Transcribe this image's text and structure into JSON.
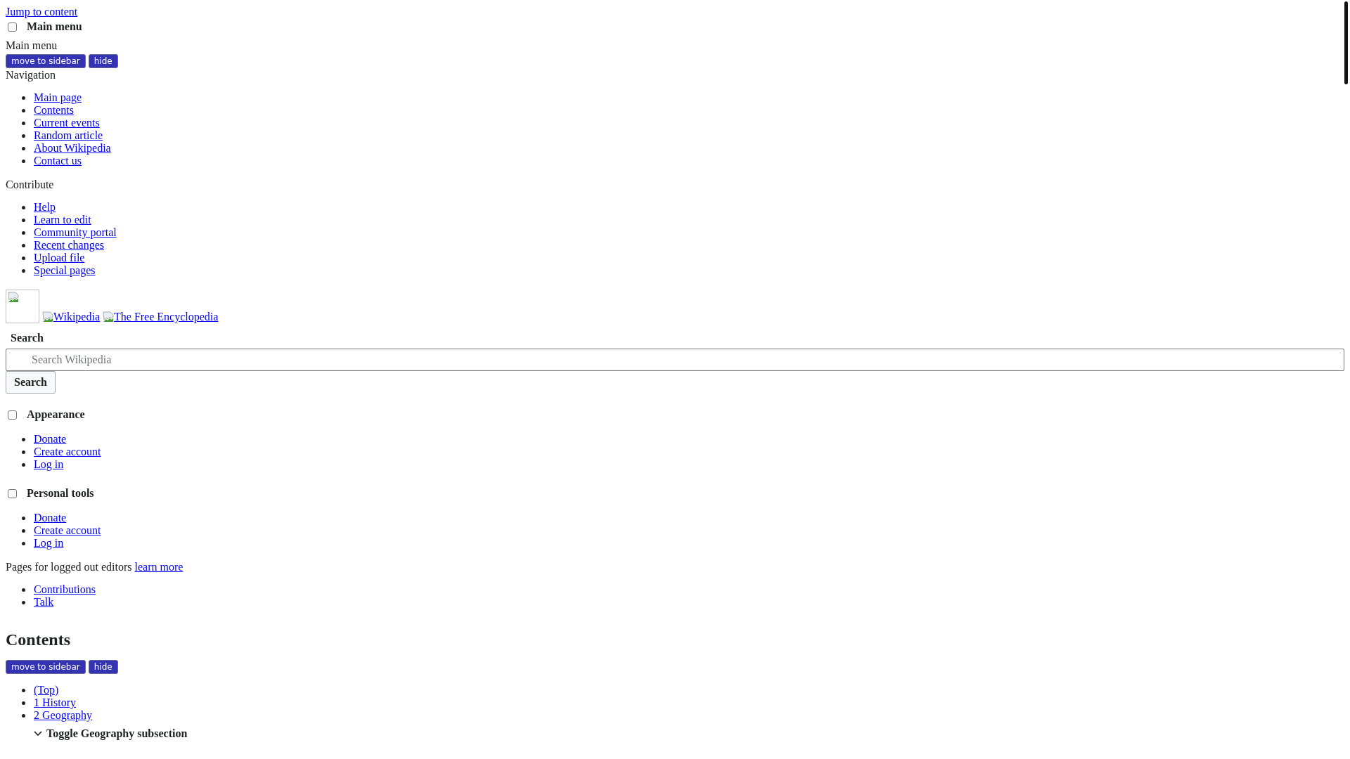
{
  "skip_link": "Jump to content",
  "main_menu": {
    "toggle": {
      "label": "Main menu",
      "checked": false
    },
    "heading": "Main menu",
    "buttons": [
      "move to sidebar",
      "hide"
    ],
    "sections": [
      {
        "heading": "Navigation",
        "items": [
          "Main page",
          "Contents",
          "Current events",
          "Random article",
          "About Wikipedia",
          "Contact us"
        ]
      },
      {
        "heading": "Contribute",
        "items": [
          "Help",
          "Learn to edit",
          "Community portal",
          "Recent changes",
          "Upload file",
          "Special pages"
        ]
      }
    ]
  },
  "logo": {
    "wordmark": "Wikipedia",
    "tagline": "The Free Encyclopedia"
  },
  "search": {
    "label": "Search",
    "placeholder": "Search Wikipedia",
    "button": "Search"
  },
  "appearance": {
    "toggle": {
      "label": "Appearance",
      "checked": false
    },
    "items": [
      "Donate",
      "Create account",
      "Log in"
    ]
  },
  "personal_tools": {
    "toggle": {
      "label": "Personal tools",
      "checked": false
    },
    "items": [
      "Donate",
      "Create account",
      "Log in"
    ]
  },
  "logged_out": {
    "text": "Pages for logged out editors",
    "link": "learn more",
    "items": [
      "Contributions",
      "Talk"
    ]
  },
  "toc": {
    "heading": "Contents",
    "buttons": [
      "move to sidebar",
      "hide"
    ],
    "items": [
      "(Top)",
      "1 History",
      "2 Geography"
    ],
    "toggle": "Toggle Geography subsection"
  }
}
